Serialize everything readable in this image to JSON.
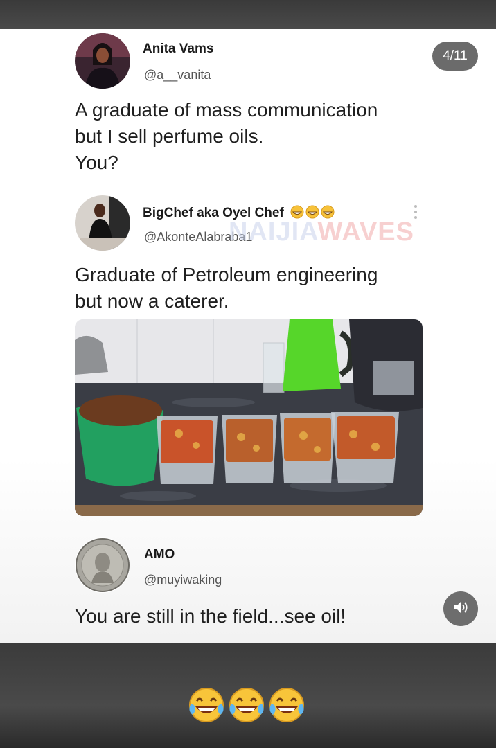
{
  "counter": "4/11",
  "tweets": [
    {
      "name": "Anita Vams",
      "handle": "@a__vanita",
      "text_lines": [
        "A graduate of mass communication",
        "but I sell perfume oils.",
        "You?"
      ]
    },
    {
      "name": "BigChef aka Oyel Chef",
      "handle": "@AkonteAlabraba1",
      "text_lines": [
        "Graduate of Petroleum engineering",
        "but now a caterer."
      ]
    },
    {
      "name": "AMO",
      "handle": "@muyiwaking",
      "text_lines": [
        "You are still in the field...see oil!"
      ]
    }
  ],
  "watermark": {
    "part1": "NAIJIA",
    "part2": "WAVES"
  },
  "icons": [
    "grinning-emoji-icon",
    "more-vertical-icon",
    "sound-icon",
    "laughing-tears-emoji-icon"
  ],
  "colors": {
    "card_bg": "#ffffff",
    "counter_bg": "#6b6b6b",
    "sound_bg": "#6d6d6d"
  }
}
